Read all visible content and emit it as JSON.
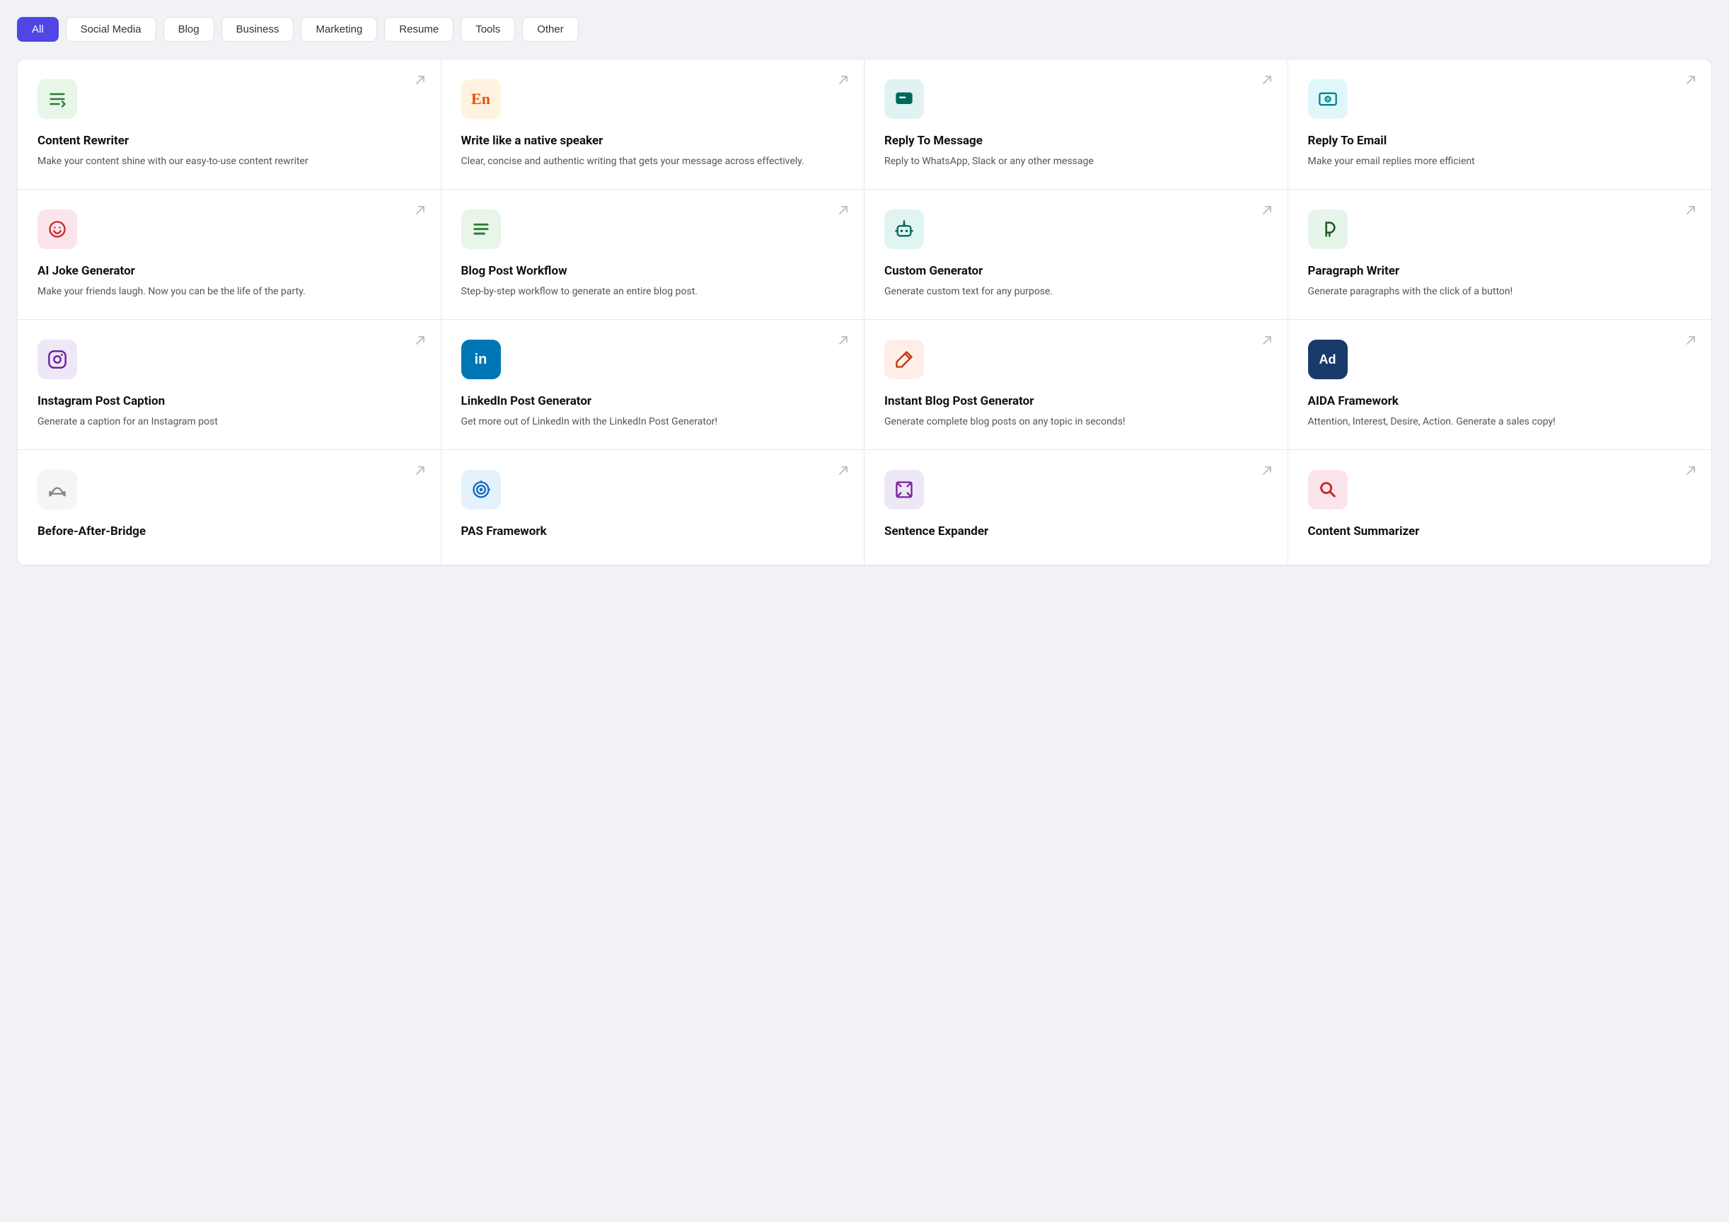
{
  "filterBar": {
    "buttons": [
      {
        "label": "All",
        "active": true
      },
      {
        "label": "Social Media",
        "active": false
      },
      {
        "label": "Blog",
        "active": false
      },
      {
        "label": "Business",
        "active": false
      },
      {
        "label": "Marketing",
        "active": false
      },
      {
        "label": "Resume",
        "active": false
      },
      {
        "label": "Tools",
        "active": false
      },
      {
        "label": "Other",
        "active": false
      }
    ]
  },
  "cards": [
    {
      "id": "content-rewriter",
      "title": "Content Rewriter",
      "desc": "Make your content shine with our easy-to-use content rewriter",
      "iconBg": "bg-green-light",
      "iconColor": "#2e7d32",
      "iconType": "svg-rewrite"
    },
    {
      "id": "native-speaker",
      "title": "Write like a native speaker",
      "desc": "Clear, concise and authentic writing that gets your message across effectively.",
      "iconBg": "bg-orange-light",
      "iconColor": "#e65100",
      "iconType": "text-En"
    },
    {
      "id": "reply-message",
      "title": "Reply To Message",
      "desc": "Reply to WhatsApp, Slack or any other message",
      "iconBg": "bg-teal-light",
      "iconColor": "#00695c",
      "iconType": "svg-message"
    },
    {
      "id": "reply-email",
      "title": "Reply To Email",
      "desc": "Make your email replies more efficient",
      "iconBg": "bg-cyan-light",
      "iconColor": "#00838f",
      "iconType": "svg-email"
    },
    {
      "id": "ai-joke",
      "title": "AI Joke Generator",
      "desc": "Make your friends laugh. Now you can be the life of the party.",
      "iconBg": "bg-red-light",
      "iconColor": "#c62828",
      "iconType": "svg-smile"
    },
    {
      "id": "blog-workflow",
      "title": "Blog Post Workflow",
      "desc": "Step-by-step workflow to generate an entire blog post.",
      "iconBg": "bg-green2-light",
      "iconColor": "#2e7d32",
      "iconType": "svg-list"
    },
    {
      "id": "custom-generator",
      "title": "Custom Generator",
      "desc": "Generate custom text for any purpose.",
      "iconBg": "bg-teal2-light",
      "iconColor": "#00695c",
      "iconType": "svg-robot"
    },
    {
      "id": "paragraph-writer",
      "title": "Paragraph Writer",
      "desc": "Generate paragraphs with the click of a button!",
      "iconBg": "bg-green3-light",
      "iconColor": "#1b5e20",
      "iconType": "svg-paragraph"
    },
    {
      "id": "instagram-caption",
      "title": "Instagram Post Caption",
      "desc": "Generate a caption for an Instagram post",
      "iconBg": "bg-purple-light",
      "iconColor": "#6a1a9a",
      "iconType": "svg-instagram"
    },
    {
      "id": "linkedin-generator",
      "title": "LinkedIn Post Generator",
      "desc": "Get more out of LinkedIn with the LinkedIn Post Generator!",
      "iconBg": "bg-blue-dark",
      "iconColor": "#ffffff",
      "iconType": "text-in"
    },
    {
      "id": "instant-blog",
      "title": "Instant Blog Post Generator",
      "desc": "Generate complete blog posts on any topic in seconds!",
      "iconBg": "bg-salmon-light",
      "iconColor": "#bf360c",
      "iconType": "svg-pen"
    },
    {
      "id": "aida-framework",
      "title": "AIDA Framework",
      "desc": "Attention, Interest, Desire, Action. Generate a sales copy!",
      "iconBg": "bg-blue2-dark",
      "iconColor": "#ffffff",
      "iconType": "text-Ad"
    },
    {
      "id": "before-after-bridge",
      "title": "Before-After-Bridge",
      "desc": "",
      "iconBg": "bg-gray-light",
      "iconColor": "#555",
      "iconType": "svg-bridge"
    },
    {
      "id": "pas-framework",
      "title": "PAS Framework",
      "desc": "",
      "iconBg": "bg-blue3-light",
      "iconColor": "#1565c0",
      "iconType": "svg-target"
    },
    {
      "id": "sentence-expander",
      "title": "Sentence Expander",
      "desc": "",
      "iconBg": "bg-purple-light",
      "iconColor": "#7b1fa2",
      "iconType": "svg-expand"
    },
    {
      "id": "content-summarizer",
      "title": "Content Summarizer",
      "desc": "",
      "iconBg": "bg-pink-light",
      "iconColor": "#c62828",
      "iconType": "svg-search"
    }
  ]
}
